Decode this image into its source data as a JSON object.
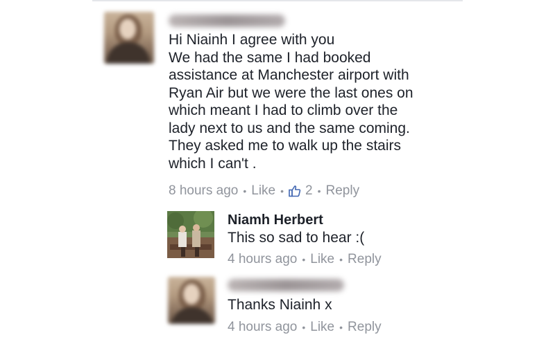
{
  "comments": [
    {
      "author": "",
      "lines": [
        "Hi Niainh  I agree with you",
        "We had the same I had booked",
        "assistance at Manchester airport with",
        "Ryan Air but we were the last ones on",
        "which meant I had to climb over the",
        "lady next to us and the same coming.",
        "They asked me to walk up the stairs",
        "which I can't ."
      ],
      "time": "8 hours ago",
      "like_label": "Like",
      "like_count": "2",
      "reply_label": "Reply"
    }
  ],
  "replies": [
    {
      "author": "Niamh Herbert",
      "text": "This so sad to hear :(",
      "time": "4 hours ago",
      "like_label": "Like",
      "reply_label": "Reply"
    },
    {
      "author": "",
      "text": "Thanks Niainh x",
      "time": "4 hours ago",
      "like_label": "Like",
      "reply_label": "Reply"
    }
  ],
  "colors": {
    "text": "#1d2129",
    "meta": "#90949c",
    "like_icon": "#4267b2"
  },
  "icons": {
    "like": "thumbs-up-icon",
    "dot": "separator-dot"
  }
}
